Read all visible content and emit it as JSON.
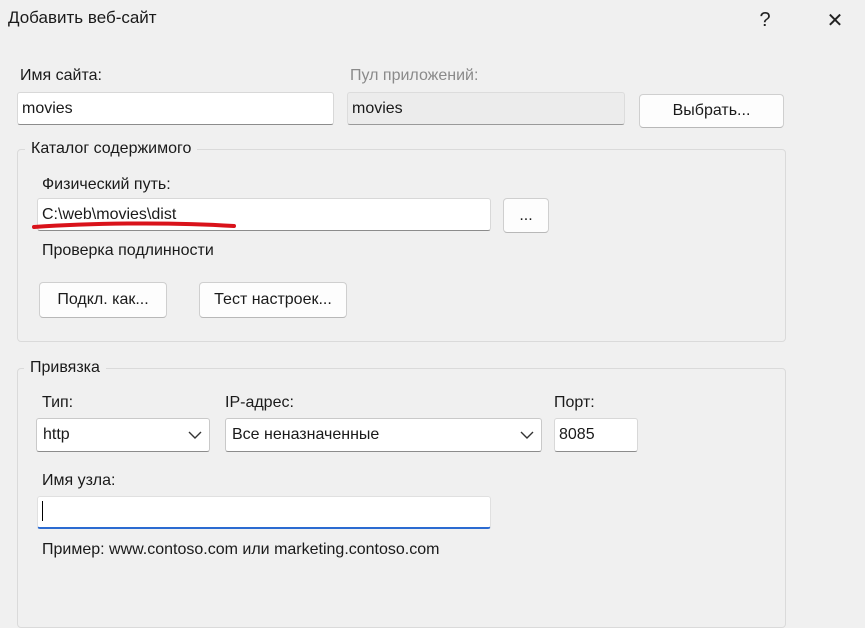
{
  "window": {
    "title": "Добавить веб-сайт",
    "help_glyph": "?",
    "close_glyph": "✕"
  },
  "site": {
    "name_label": "Имя сайта:",
    "name_value": "movies",
    "pool_label": "Пул приложений:",
    "pool_value": "movies",
    "select_button": "Выбрать..."
  },
  "content": {
    "group_label": "Каталог содержимого",
    "path_label": "Физический путь:",
    "path_value": "C:\\web\\movies\\dist",
    "browse_button": "...",
    "auth_label": "Проверка подлинности",
    "connect_as_button": "Подкл. как...",
    "test_settings_button": "Тест настроек..."
  },
  "binding": {
    "group_label": "Привязка",
    "type_label": "Тип:",
    "type_value": "http",
    "ip_label": "IP-адрес:",
    "ip_value": "Все неназначенные",
    "port_label": "Порт:",
    "port_value": "8085",
    "host_label": "Имя узла:",
    "host_value": "",
    "example_text": "Пример: www.contoso.com или marketing.contoso.com"
  },
  "colors": {
    "annotation_underline": "#d9121a",
    "focus_accent": "#2b6bd1"
  },
  "icons": [
    "help-icon",
    "close-icon",
    "chevron-down-icon"
  ]
}
